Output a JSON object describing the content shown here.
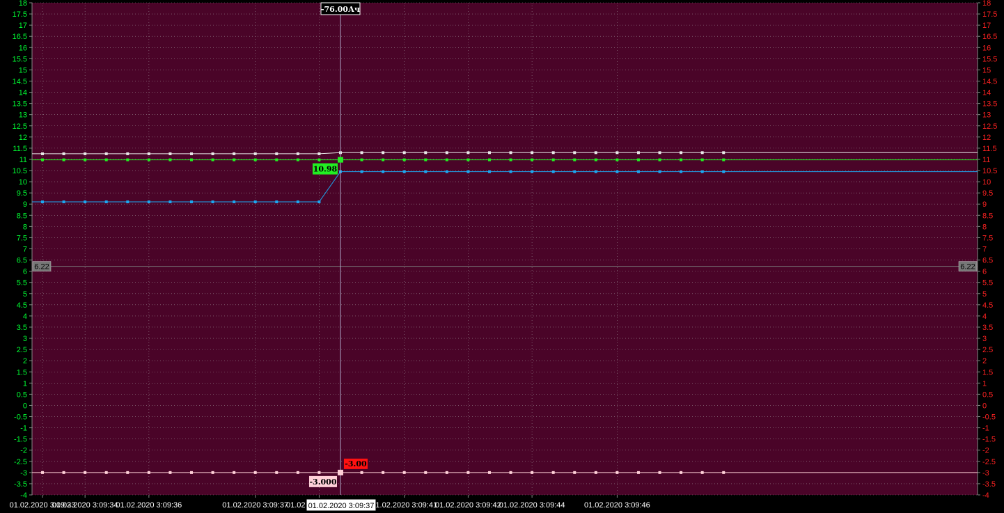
{
  "chart_data": {
    "type": "line",
    "x": [
      "01.02.2020 3:09:33",
      "",
      "01.02.2020 3:09:34",
      "",
      "",
      "01.02.2020 3:09:36",
      "",
      "",
      "",
      "",
      "01.02.2020 3:09:37",
      "",
      "",
      "01.02.2020 3:09:39",
      "",
      "",
      "",
      "01.02.2020 3:09:41",
      "",
      "",
      "01.02.2020 3:09:42",
      "",
      "",
      "01.02.2020 3:09:44",
      "",
      "",
      "",
      "01.02.2020 3:09:46",
      "",
      "",
      "",
      "",
      ""
    ],
    "x_axis_labels": [
      "01.02.2020 3:09:33",
      "01.02.2020 3:09:34",
      "01.02.2020 3:09:36",
      "01.02.2020 3:09:37",
      "01.02.2020 3:09:39",
      "01.02.2020 3:09:41",
      "01.02.2020 3:09:42",
      "01.02.2020 3:09:44",
      "01.02.2020 3:09:46"
    ],
    "y_left": {
      "min": -4,
      "max": 18,
      "step": 0.5,
      "color": "#00ff33"
    },
    "y_right": {
      "min": -4,
      "max": 18,
      "step": 0.5,
      "color": "#ff2222"
    },
    "grid": true,
    "background": "#4a0428",
    "series": [
      {
        "color": "#e8e8e8",
        "values_before": 11.25,
        "values_after": 11.3,
        "break_index": 14
      },
      {
        "color": "#22ee22",
        "values_before": 10.98,
        "values_after": 10.98,
        "break_index": 14
      },
      {
        "color": "#1ca8f0",
        "values_before": 9.1,
        "values_after": 10.45,
        "break_index": 14
      },
      {
        "color": "#ffd0d8",
        "values_before": -3.0,
        "values_after": -3.0,
        "break_index": 14
      }
    ],
    "reference_line": {
      "value": 6.22,
      "label": "6.22",
      "color": "#777777"
    },
    "cursor": {
      "time_label": "01.02.2020 3:09:37",
      "top_label": "-76.00Ач",
      "value_label_green": "10.98",
      "value_label_pink": "-3.000",
      "value_label_red": "-3.00"
    }
  }
}
